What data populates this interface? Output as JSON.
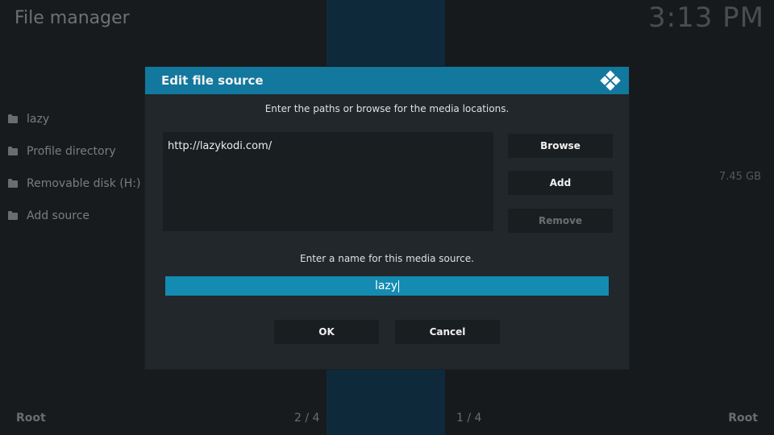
{
  "app": {
    "title": "File manager",
    "clock": "3:13 PM"
  },
  "sidebar": {
    "items": [
      {
        "label": "lazy",
        "icon": "folder-icon"
      },
      {
        "label": "Profile directory",
        "icon": "folder-icon"
      },
      {
        "label": "Removable disk (H:)",
        "icon": "folder-icon"
      },
      {
        "label": "Add source",
        "icon": "folder-icon"
      }
    ],
    "disk_size": "7.45 GB"
  },
  "footer": {
    "left_label": "Root",
    "left_page": "2 / 4",
    "right_page": "1 / 4",
    "right_label": "Root"
  },
  "dialog": {
    "title": "Edit file source",
    "instruction_paths": "Enter the paths or browse for the media locations.",
    "paths": [
      "http://lazykodi.com/"
    ],
    "buttons": {
      "browse": "Browse",
      "add": "Add",
      "remove": "Remove"
    },
    "instruction_name": "Enter a name for this media source.",
    "name_value": "lazy",
    "ok": "OK",
    "cancel": "Cancel"
  },
  "colors": {
    "accent": "#12789e",
    "input_highlight": "#148bb1",
    "dialog_bg": "#21272b",
    "field_bg": "#191e21"
  }
}
